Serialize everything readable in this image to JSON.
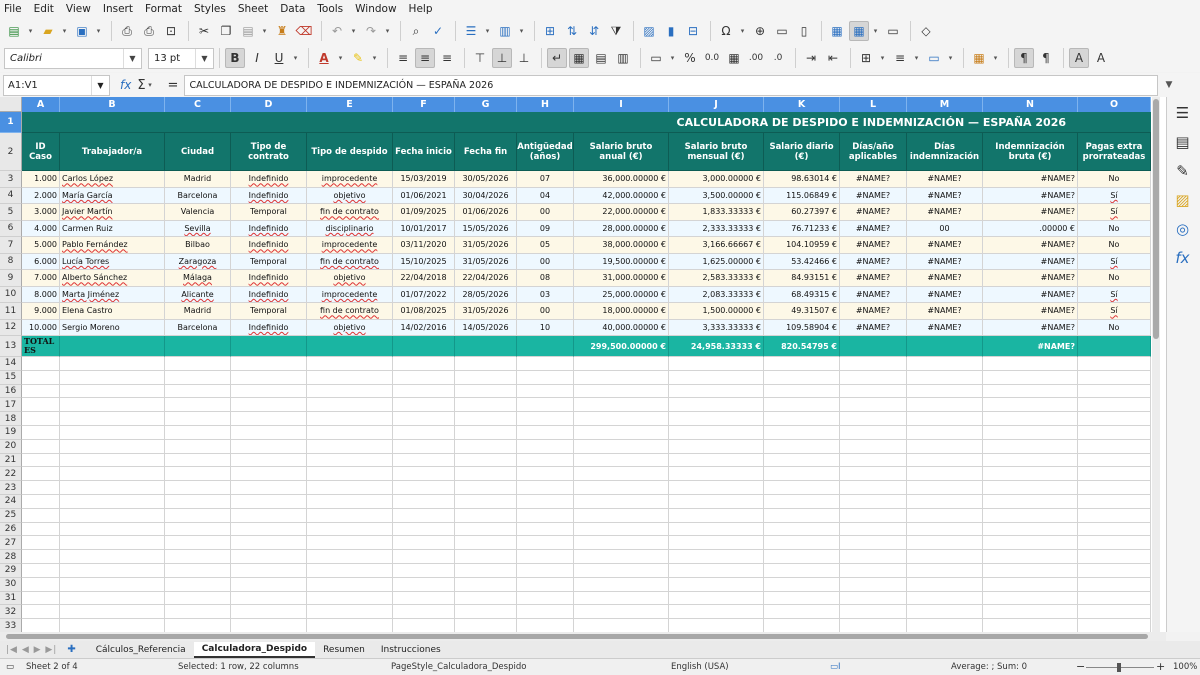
{
  "menu": [
    "File",
    "Edit",
    "View",
    "Insert",
    "Format",
    "Styles",
    "Sheet",
    "Data",
    "Tools",
    "Window",
    "Help"
  ],
  "toolbar": {
    "font_name": "Calibri",
    "font_size": "13 pt",
    "bold_label": "B",
    "italic_label": "I",
    "underline_label": "U",
    "percent_label": "%",
    "decimal_label": "0.0",
    "add_decimal_label": ".00",
    "del_decimal_label": ".0"
  },
  "formula_bar": {
    "cell_ref": "A1:V1",
    "fx": "fx",
    "sum": "Σ",
    "eq": "=",
    "content": "CALCULADORA DE DESPIDO E INDEMNIZACIÓN — ESPAÑA 2026"
  },
  "columns": [
    "A",
    "B",
    "C",
    "D",
    "E",
    "F",
    "G",
    "H",
    "I",
    "J",
    "K",
    "L",
    "M",
    "N",
    "O"
  ],
  "row_numbers": [
    "1",
    "2",
    "3",
    "4",
    "5",
    "6",
    "7",
    "8",
    "9",
    "10",
    "11",
    "12",
    "13",
    "14",
    "15",
    "16",
    "17",
    "18",
    "19",
    "20",
    "21",
    "22",
    "23",
    "24",
    "25",
    "26",
    "27",
    "28",
    "29",
    "30",
    "31",
    "32",
    "33"
  ],
  "sheet": {
    "title": "CALCULADORA DE DESPIDO E INDEMNIZACIÓN — ESPAÑA 2026",
    "headers": [
      "ID Caso",
      "Trabajador/a",
      "Ciudad",
      "Tipo de contrato",
      "Tipo de despido",
      "Fecha inicio",
      "Fecha fin",
      "Antigüedad (años)",
      "Salario bruto anual (€)",
      "Salario bruto mensual (€)",
      "Salario diario (€)",
      "Días/año aplicables",
      "Días indemnización",
      "Indemnización bruta (€)",
      "Pagas extra prorrateadas"
    ],
    "rows": [
      [
        "1.000",
        "Carlos López",
        "Madrid",
        "Indefinido",
        "improcedente",
        "15/03/2019",
        "30/05/2026",
        "07",
        "36,000.00000 €",
        "3,000.00000 €",
        "98.63014 €",
        "#NAME?",
        "#NAME?",
        "#NAME?",
        "No"
      ],
      [
        "2.000",
        "María García",
        "Barcelona",
        "Indefinido",
        "objetivo",
        "01/06/2021",
        "30/04/2026",
        "04",
        "42,000.00000 €",
        "3,500.00000 €",
        "115.06849 €",
        "#NAME?",
        "#NAME?",
        "#NAME?",
        "Sí"
      ],
      [
        "3.000",
        "Javier Martín",
        "Valencia",
        "Temporal",
        "fin de contrato",
        "01/09/2025",
        "01/06/2026",
        "00",
        "22,000.00000 €",
        "1,833.33333 €",
        "60.27397 €",
        "#NAME?",
        "#NAME?",
        "#NAME?",
        "Sí"
      ],
      [
        "4.000",
        "Carmen Ruiz",
        "Sevilla",
        "Indefinido",
        "disciplinario",
        "10/01/2017",
        "15/05/2026",
        "09",
        "28,000.00000 €",
        "2,333.33333 €",
        "76.71233 €",
        "#NAME?",
        "00",
        ".00000 €",
        "No"
      ],
      [
        "5.000",
        "Pablo Fernández",
        "Bilbao",
        "Indefinido",
        "improcedente",
        "03/11/2020",
        "31/05/2026",
        "05",
        "38,000.00000 €",
        "3,166.66667 €",
        "104.10959 €",
        "#NAME?",
        "#NAME?",
        "#NAME?",
        "No"
      ],
      [
        "6.000",
        "Lucía Torres",
        "Zaragoza",
        "Temporal",
        "fin de contrato",
        "15/10/2025",
        "31/05/2026",
        "00",
        "19,500.00000 €",
        "1,625.00000 €",
        "53.42466 €",
        "#NAME?",
        "#NAME?",
        "#NAME?",
        "Sí"
      ],
      [
        "7.000",
        "Alberto Sánchez",
        "Málaga",
        "Indefinido",
        "objetivo",
        "22/04/2018",
        "22/04/2026",
        "08",
        "31,000.00000 €",
        "2,583.33333 €",
        "84.93151 €",
        "#NAME?",
        "#NAME?",
        "#NAME?",
        "No"
      ],
      [
        "8.000",
        "Marta Jiménez",
        "Alicante",
        "Indefinido",
        "improcedente",
        "01/07/2022",
        "28/05/2026",
        "03",
        "25,000.00000 €",
        "2,083.33333 €",
        "68.49315 €",
        "#NAME?",
        "#NAME?",
        "#NAME?",
        "Sí"
      ],
      [
        "9.000",
        "Elena Castro",
        "Madrid",
        "Temporal",
        "fin de contrato",
        "01/08/2025",
        "31/05/2026",
        "00",
        "18,000.00000 €",
        "1,500.00000 €",
        "49.31507 €",
        "#NAME?",
        "#NAME?",
        "#NAME?",
        "Sí"
      ],
      [
        "10.000",
        "Sergio Moreno",
        "Barcelona",
        "Indefinido",
        "objetivo",
        "14/02/2016",
        "14/05/2026",
        "10",
        "40,000.00000 €",
        "3,333.33333 €",
        "109.58904 €",
        "#NAME?",
        "#NAME?",
        "#NAME?",
        "No"
      ]
    ],
    "totals": [
      "TOTALES",
      "",
      "",
      "",
      "",
      "",
      "",
      "",
      "299,500.00000 €",
      "24,958.33333 €",
      "820.54795 €",
      "",
      "",
      "#NAME?",
      ""
    ]
  },
  "tabs": [
    "Cálculos_Referencia",
    "Calculadora_Despido",
    "Resumen",
    "Instrucciones"
  ],
  "active_tab": "Calculadora_Despido",
  "status": {
    "sheet": "Sheet 2 of 4",
    "selection": "Selected: 1 row, 22 columns",
    "page_style": "PageStyle_Calculadora_Despido",
    "language": "English (USA)",
    "stats": "Average: ; Sum: 0",
    "zoom": "100%"
  }
}
